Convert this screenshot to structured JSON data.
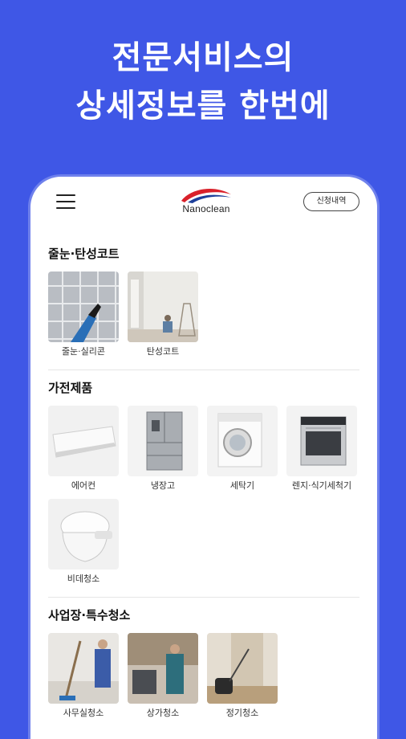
{
  "headline": {
    "line1": "전문서비스의",
    "line2": "상세정보를 한번에"
  },
  "app": {
    "logo_text": "Nanoclean",
    "request_button": "신청내역",
    "colors": {
      "background": "#3f57e6",
      "logo_red": "#d9212b",
      "logo_blue": "#1d3f9a"
    }
  },
  "sections": [
    {
      "title": "줄눈·탄성코트",
      "items": [
        {
          "label": "줄눈·실리콘",
          "icon": "grout-silicone-photo"
        },
        {
          "label": "탄성코트",
          "icon": "elastic-coat-photo"
        }
      ]
    },
    {
      "title": "가전제품",
      "items": [
        {
          "label": "에어컨",
          "icon": "air-conditioner-photo"
        },
        {
          "label": "냉장고",
          "icon": "refrigerator-photo"
        },
        {
          "label": "세탁기",
          "icon": "washing-machine-photo"
        },
        {
          "label": "렌지·식기세척기",
          "icon": "range-dishwasher-photo"
        },
        {
          "label": "비데청소",
          "icon": "bidet-photo"
        }
      ]
    },
    {
      "title": "사업장·특수청소",
      "items": [
        {
          "label": "사무실청소",
          "icon": "office-cleaning-photo"
        },
        {
          "label": "상가청소",
          "icon": "store-cleaning-photo"
        },
        {
          "label": "정기청소",
          "icon": "regular-cleaning-photo"
        }
      ]
    }
  ]
}
